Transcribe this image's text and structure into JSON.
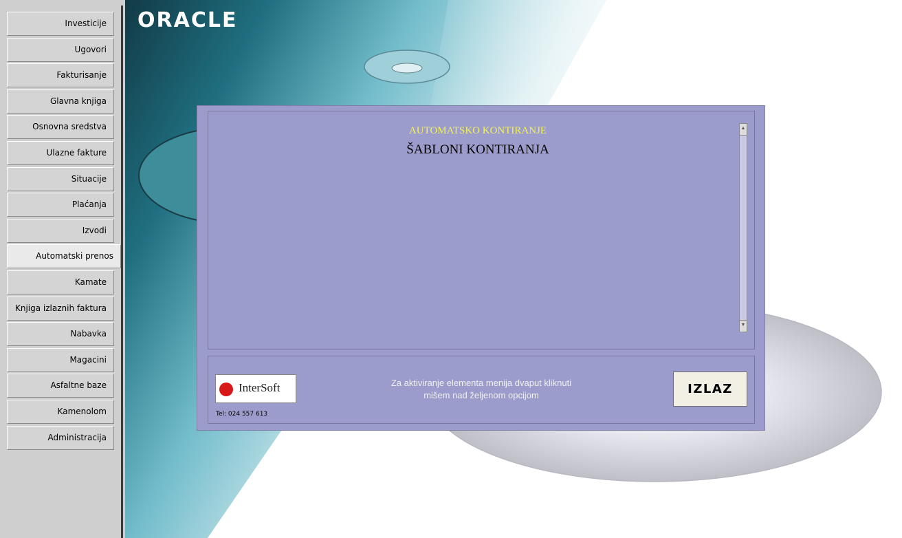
{
  "sidebar": {
    "items": [
      {
        "label": "Investicije"
      },
      {
        "label": "Ugovori"
      },
      {
        "label": "Fakturisanje"
      },
      {
        "label": "Glavna knjiga"
      },
      {
        "label": "Osnovna sredstva"
      },
      {
        "label": "Ulazne fakture"
      },
      {
        "label": "Situacije"
      },
      {
        "label": "Plaćanja"
      },
      {
        "label": "Izvodi"
      },
      {
        "label": "Automatski prenos"
      },
      {
        "label": "Kamate"
      },
      {
        "label": "Knjiga izlaznih faktura"
      },
      {
        "label": "Nabavka"
      },
      {
        "label": "Magacini"
      },
      {
        "label": "Asfaltne baze"
      },
      {
        "label": "Kamenolom"
      },
      {
        "label": "Administracija"
      }
    ],
    "active_index": 9
  },
  "background": {
    "brand": "ORACLE"
  },
  "panel": {
    "title": "AUTOMATSKO KONTIRANJE",
    "subtitle": "ŠABLONI KONTIRANJA",
    "hint_line1": "Za aktiviranje elementa menija dvaput kliknuti",
    "hint_line2": "mišem nad željenom opcijom",
    "exit_label": "IZLAZ",
    "logo_text": "InterSoft",
    "tel": "Tel: 024 557 613"
  },
  "colors": {
    "panel_bg": "#9c9ccc",
    "title_yellow": "#f2f256",
    "sidebar_bg": "#cfcfcf"
  }
}
